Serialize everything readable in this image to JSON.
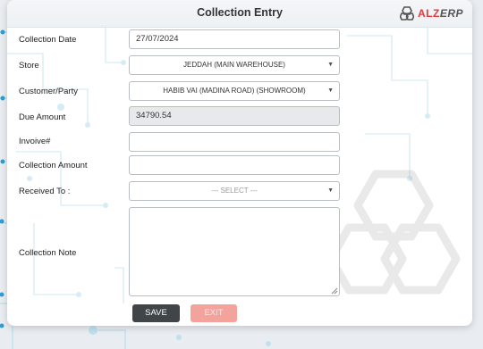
{
  "window": {
    "title": "Collection Entry",
    "brand": {
      "prefix": "ALZ",
      "suffix": "ERP"
    }
  },
  "form": {
    "collection_date": {
      "label": "Collection Date",
      "value": "27/07/2024"
    },
    "store": {
      "label": "Store",
      "value": "JEDDAH (MAIN WAREHOUSE)"
    },
    "customer": {
      "label": "Customer/Party",
      "value": "HABIB VAI (MADINA ROAD) (SHOWROOM)"
    },
    "due_amount": {
      "label": "Due Amount",
      "value": "34790.54"
    },
    "invoice": {
      "label": "Invoive#",
      "value": ""
    },
    "collection_amount": {
      "label": "Collection Amount",
      "value": ""
    },
    "received_to": {
      "label": "Received To :",
      "value": "--- SELECT ---"
    },
    "collection_note": {
      "label": "Collection Note",
      "value": ""
    }
  },
  "actions": {
    "save_label": "SAVE",
    "exit_label": "EXIT"
  },
  "colors": {
    "brand_red": "#e23b3b",
    "save_button": "#414548",
    "exit_button": "#f4a39c",
    "circuit": "#bfe1ee"
  },
  "icons": {
    "dropdown": "chevron-down-icon",
    "logo": "alzerp-logo-icon"
  }
}
